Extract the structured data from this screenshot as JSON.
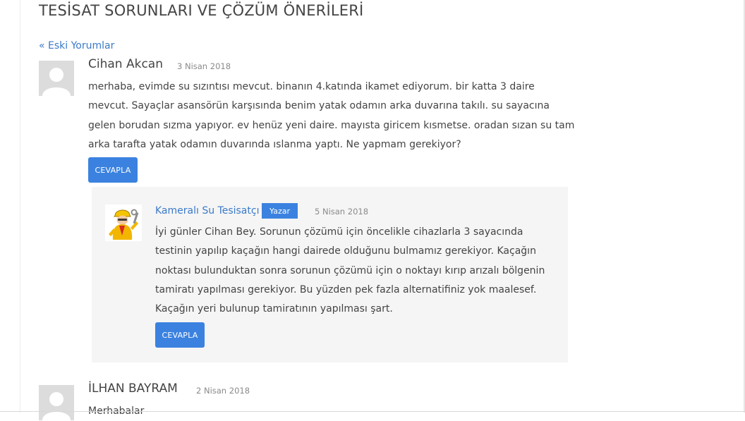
{
  "section": {
    "title": "TESİSAT SORUNLARI VE ÇÖZÜM ÖNERİLERİ"
  },
  "navigation": {
    "older_comments": "« Eski Yorumlar"
  },
  "comments": [
    {
      "author": "Cihan Akcan",
      "date": "3 Nisan 2018",
      "avatar": "default-avatar-icon",
      "lines": [
        "merhaba, evimde su sızıntısı mevcut. binanın 4.katında ikamet ediyorum. bir katta 3 daire",
        "mevcut. Sayaçlar asansörün karşısında benim yatak odamın arka duvarına takılı. su sayacına",
        "gelen borudan sızma yapıyor. ev henüz yeni daire. mayısta giricem kısmetse. oradan sızan su tam",
        "arka tarafta yatak odamın duvarında ıslanma yaptı. Ne yapmam gerekiyor?"
      ],
      "reply_label": "CEVAPLA",
      "reply": {
        "author": "Kameralı Su Tesisatçı",
        "badge": "Yazar",
        "date": "5 Nisan 2018",
        "avatar": "plumber-mascot-icon",
        "lines": [
          "İyi günler Cihan Bey. Sorunun çözümü için öncelikle cihazlarla 3 sayacında",
          "testinin yapılıp kaçağın hangi dairede olduğunu bulmamız gerekiyor. Kaçağın",
          "noktası bulunduktan sonra sorunun çözümü için o noktayı kırıp arızalı bölgenin",
          "tamiratı yapılması gerekiyor. Bu yüzden pek fazla alternatifiniz yok maalesef.",
          "Kaçağın yeri bulunup tamiratının yapılması şart."
        ],
        "reply_label": "CEVAPLA"
      }
    },
    {
      "author": "İLHAN BAYRAM",
      "date": "2 Nisan 2018",
      "avatar": "default-avatar-icon",
      "lines": [
        "Merhabalar"
      ]
    }
  ],
  "colors": {
    "link": "#3a7ac8",
    "button": "#3b82e0",
    "reply_background": "#f5f5f5",
    "avatar_placeholder": "#dcdcdc"
  }
}
